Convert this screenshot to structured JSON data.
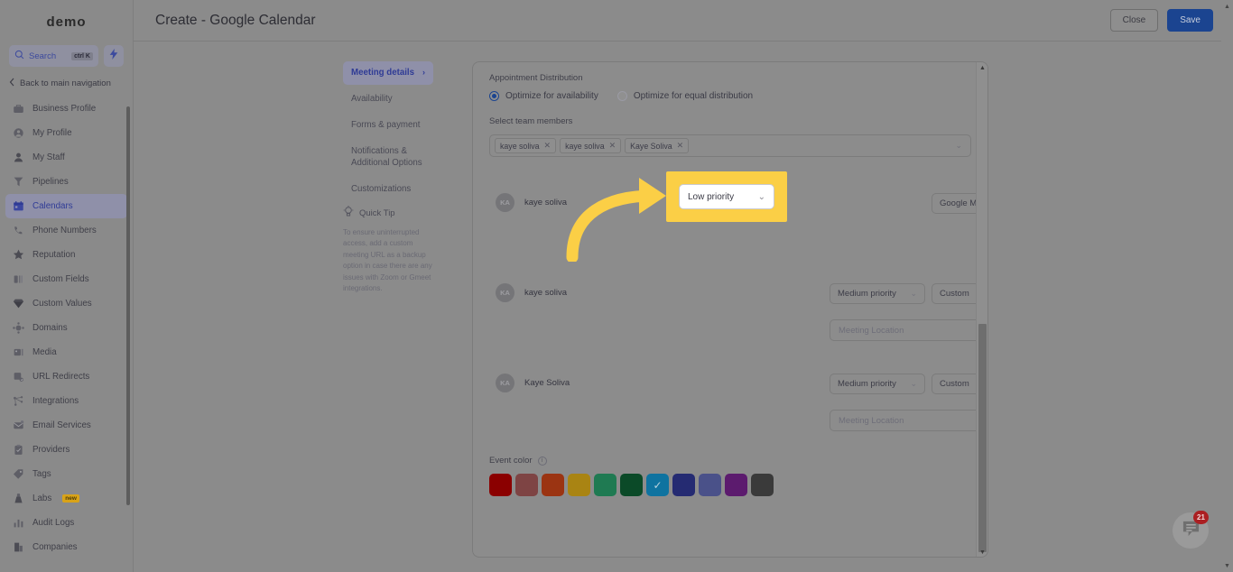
{
  "sidebar": {
    "brand": "demo",
    "search": {
      "placeholder": "Search",
      "shortcut": "ctrl K",
      "icon": "search-icon"
    },
    "quick_action_icon": "lightning-icon",
    "back_label": "Back to main navigation",
    "items": [
      {
        "label": "Business Profile",
        "icon": "briefcase-icon",
        "active": false
      },
      {
        "label": "My Profile",
        "icon": "user-circle-icon",
        "active": false
      },
      {
        "label": "My Staff",
        "icon": "person-icon",
        "active": false
      },
      {
        "label": "Pipelines",
        "icon": "funnel-icon",
        "active": false
      },
      {
        "label": "Calendars",
        "icon": "calendar-icon",
        "active": true
      },
      {
        "label": "Phone Numbers",
        "icon": "phone-icon",
        "active": false
      },
      {
        "label": "Reputation",
        "icon": "star-icon",
        "active": false
      },
      {
        "label": "Custom Fields",
        "icon": "fields-icon",
        "active": false
      },
      {
        "label": "Custom Values",
        "icon": "diamond-icon",
        "active": false
      },
      {
        "label": "Domains",
        "icon": "globe-icon",
        "active": false
      },
      {
        "label": "Media",
        "icon": "media-icon",
        "active": false
      },
      {
        "label": "URL Redirects",
        "icon": "redirect-icon",
        "active": false
      },
      {
        "label": "Integrations",
        "icon": "nodes-icon",
        "active": false
      },
      {
        "label": "Email Services",
        "icon": "envelope-icon",
        "active": false
      },
      {
        "label": "Providers",
        "icon": "clipboard-icon",
        "active": false
      },
      {
        "label": "Tags",
        "icon": "tag-icon",
        "active": false
      },
      {
        "label": "Labs",
        "icon": "flask-icon",
        "active": false,
        "badge": "new"
      },
      {
        "label": "Audit Logs",
        "icon": "bars-icon",
        "active": false
      },
      {
        "label": "Companies",
        "icon": "building-icon",
        "active": false
      }
    ]
  },
  "header": {
    "title": "Create - Google Calendar",
    "close_label": "Close",
    "save_label": "Save"
  },
  "tabs": [
    {
      "label": "Meeting details",
      "active": true
    },
    {
      "label": "Availability",
      "active": false
    },
    {
      "label": "Forms & payment",
      "active": false
    },
    {
      "label": "Notifications & Additional Options",
      "active": false
    },
    {
      "label": "Customizations",
      "active": false
    }
  ],
  "quick_tip": {
    "title": "Quick Tip",
    "icon": "lightbulb-icon",
    "body": "To ensure uninterrupted access, add a custom meeting URL as a backup option in case there are any issues with Zoom or Gmeet integrations."
  },
  "main": {
    "distribution_label": "Appointment Distribution",
    "radio_options": [
      {
        "label": "Optimize for availability",
        "selected": true
      },
      {
        "label": "Optimize for equal distribution",
        "selected": false
      }
    ],
    "team_members_label": "Select team members",
    "chips": [
      "kaye soliva",
      "kaye soliva",
      "Kaye Soliva"
    ],
    "members": [
      {
        "initials": "KA",
        "name": "kaye soliva",
        "priority": "Low priority",
        "meeting_type": "Google Meet",
        "highlighted": true,
        "show_location_input": false
      },
      {
        "initials": "KA",
        "name": "kaye soliva",
        "priority": "Medium priority",
        "meeting_type": "Custom",
        "highlighted": false,
        "show_location_input": true,
        "location_placeholder": "Meeting Location"
      },
      {
        "initials": "KA",
        "name": "Kaye Soliva",
        "priority": "Medium priority",
        "meeting_type": "Custom",
        "highlighted": false,
        "show_location_input": true,
        "location_placeholder": "Meeting Location"
      }
    ],
    "event_color_label": "Event color",
    "event_colors": [
      {
        "hex": "#8b0000",
        "selected": false
      },
      {
        "hex": "#7e4444",
        "selected": false
      },
      {
        "hex": "#9b3412",
        "selected": false
      },
      {
        "hex": "#a98413",
        "selected": false
      },
      {
        "hex": "#1f7a52",
        "selected": false
      },
      {
        "hex": "#0b4a28",
        "selected": false
      },
      {
        "hex": "#0f73a0",
        "selected": true
      },
      {
        "hex": "#252b72",
        "selected": false
      },
      {
        "hex": "#4a5189",
        "selected": false
      },
      {
        "hex": "#5c1b6e",
        "selected": false
      },
      {
        "hex": "#3a3a3a",
        "selected": false
      }
    ],
    "delete_icon": "trash-icon",
    "dropdown_caret_icon": "chevron-down-icon"
  },
  "chat_widget": {
    "icon": "chat-bubble-icon",
    "badge": "21"
  }
}
